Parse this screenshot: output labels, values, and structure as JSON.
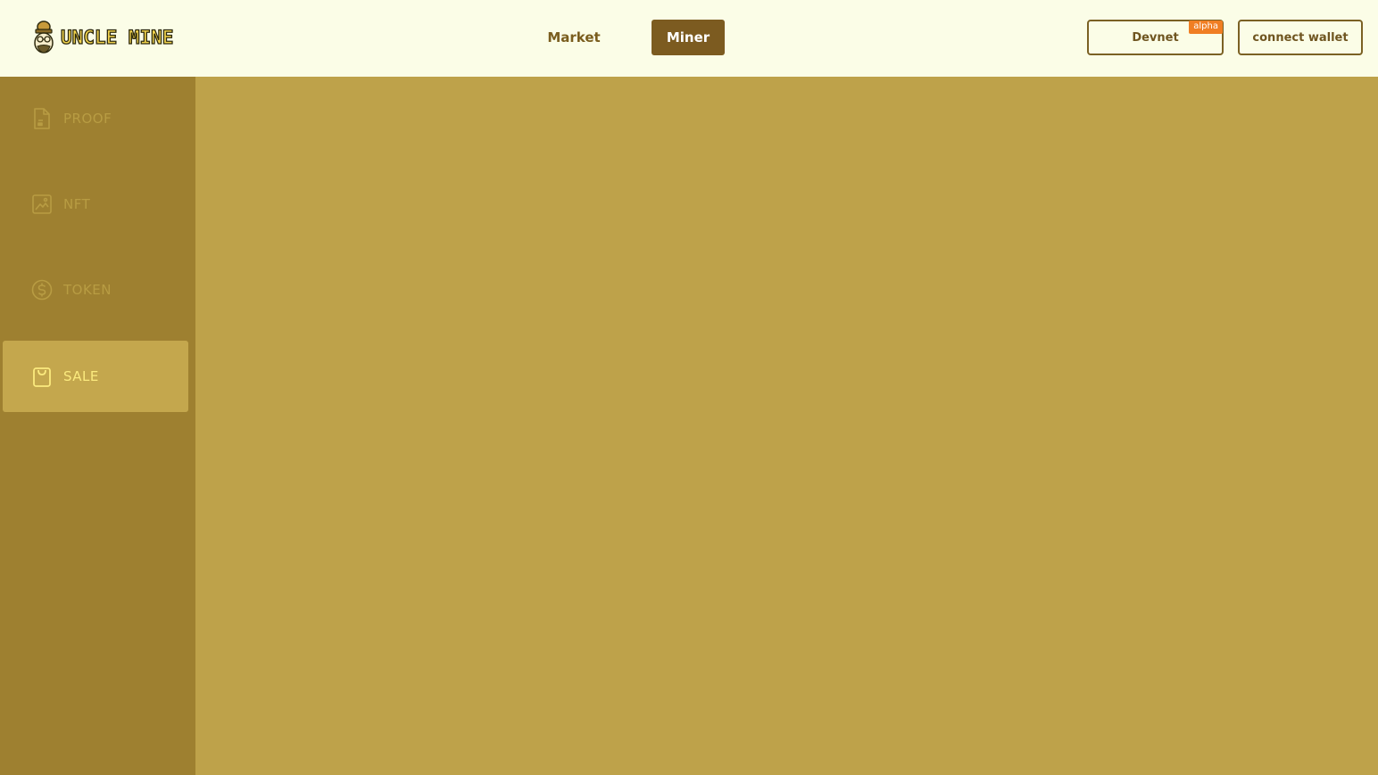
{
  "header": {
    "logo_text": "UNCLE MINE",
    "nav": [
      {
        "label": "Market",
        "active": false
      },
      {
        "label": "Miner",
        "active": true
      }
    ],
    "network_button": {
      "label": "Devnet",
      "badge": "alpha"
    },
    "wallet_button": {
      "label": "connect wallet"
    }
  },
  "sidebar": {
    "items": [
      {
        "label": "PROOF",
        "icon": "document-icon",
        "active": false
      },
      {
        "label": "NFT",
        "icon": "image-icon",
        "active": false
      },
      {
        "label": "TOKEN",
        "icon": "coin-icon",
        "active": false
      },
      {
        "label": "SALE",
        "icon": "shopping-bag-icon",
        "active": true
      }
    ]
  },
  "colors": {
    "header_bg": "#FBFDE7",
    "sidebar_bg": "#9E8030",
    "main_bg": "#BEA24A",
    "accent_brown": "#7C5B20",
    "badge_orange": "#F07E23",
    "active_label": "#FBEA7E"
  }
}
